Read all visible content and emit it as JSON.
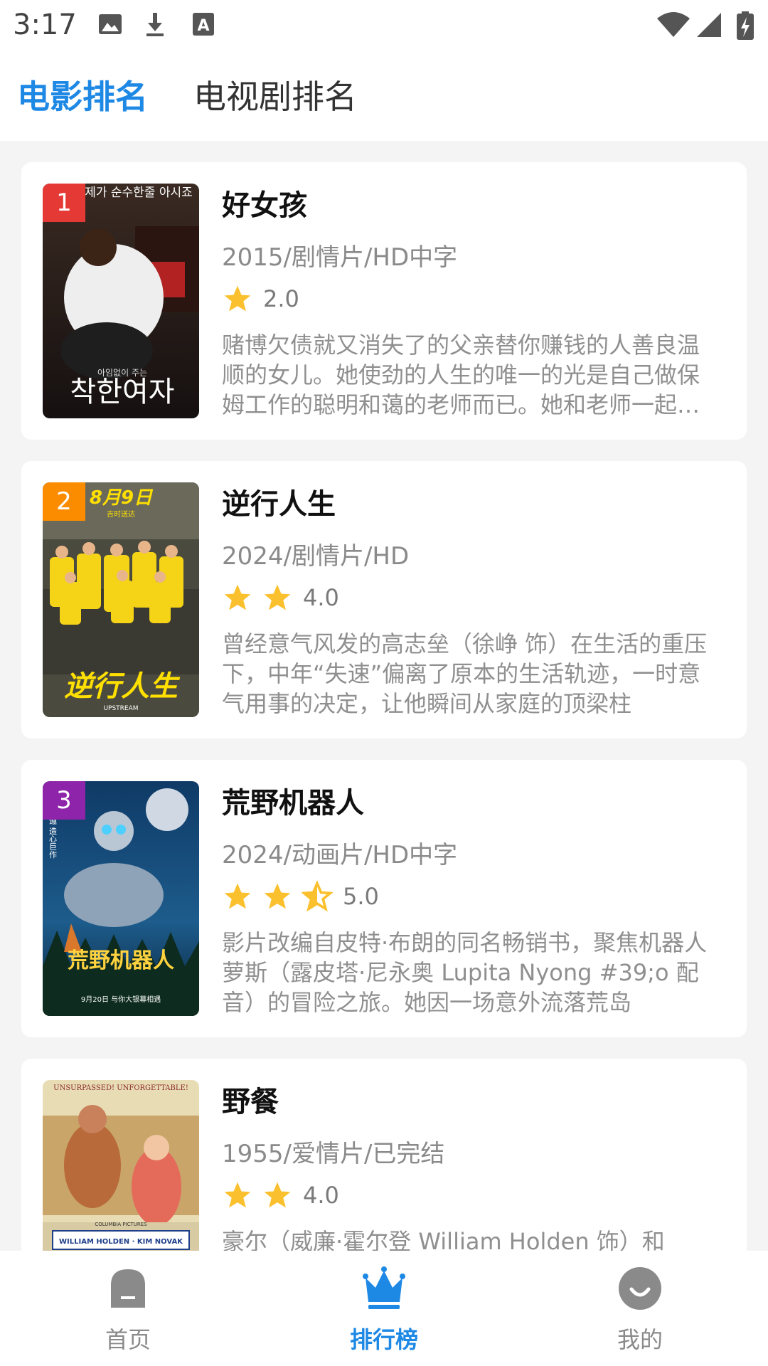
{
  "status_bar": {
    "time": "3:17",
    "left_icons": [
      "image-icon",
      "download-icon",
      "text-a-icon"
    ],
    "right_icons": [
      "wifi-icon",
      "signal-icon",
      "battery-icon"
    ]
  },
  "tabs": [
    {
      "label": "电影排名",
      "active": true
    },
    {
      "label": "电视剧排名",
      "active": false
    }
  ],
  "colors": {
    "accent": "#1e88e5",
    "star": "#fbc02d",
    "rank1": "#e53935",
    "rank2": "#fb8c00",
    "rank3": "#8e24aa"
  },
  "movies": [
    {
      "rank": "1",
      "poster_text": "제가 순수한줄 아시죠",
      "poster_title": "착한여자",
      "poster_subtitle": "아임없이 주는",
      "title": "好女孩",
      "meta": "2015/剧情片/HD中字",
      "stars": 1,
      "score": "2.0",
      "desc": "赌博欠债就又消失了的父亲替你赚钱的人善良温顺的女儿。她使劲的人生的唯一的光是自己做保姆工作的聪明和蔼的老师而已。她和老师一起生活的时候"
    },
    {
      "rank": "2",
      "poster_text": "8月9日",
      "poster_subtitle": "吉时送达",
      "poster_title": "逆行人生",
      "poster_caption": "UPSTREAM",
      "title": "逆行人生",
      "meta": "2024/剧情片/HD",
      "stars": 2,
      "score": "4.0",
      "desc": "曾经意气风发的高志垒（徐峥 饰）在生活的重压下，中年“失速”偏离了原本的生活轨迹，一时意气用事的决定，让他瞬间从家庭的顶梁柱"
    },
    {
      "rank": "3",
      "poster_text": "遵 造心巨作",
      "poster_title": "荒野机器人",
      "poster_caption": "9月20日 与你大银幕相遇",
      "title": "荒野机器人",
      "meta": "2024/动画片/HD中字",
      "stars": 2.5,
      "score": "5.0",
      "desc": "影片改编自皮特·布朗的同名畅销书，聚焦机器人萝斯（露皮塔·尼永奥 Lupita Nyong #39;o 配音）的冒险之旅。她因一场意外流落荒岛"
    },
    {
      "rank": "",
      "poster_text": "UNSURPASSED! UNFORGETTABLE!",
      "poster_title": "WILLIAM HOLDEN · KIM NOVAK",
      "poster_caption": "COLUMBIA PICTURES",
      "title": "野餐",
      "meta": "1955/爱情片/已完结",
      "stars": 2,
      "score": "4.0",
      "desc": "豪尔（威廉·霍尔登 William Holden 饰）和"
    }
  ],
  "bottom_nav": [
    {
      "label": "首页",
      "icon": "home-icon",
      "active": false
    },
    {
      "label": "排行榜",
      "icon": "crown-icon",
      "active": true
    },
    {
      "label": "我的",
      "icon": "smile-icon",
      "active": false
    }
  ]
}
